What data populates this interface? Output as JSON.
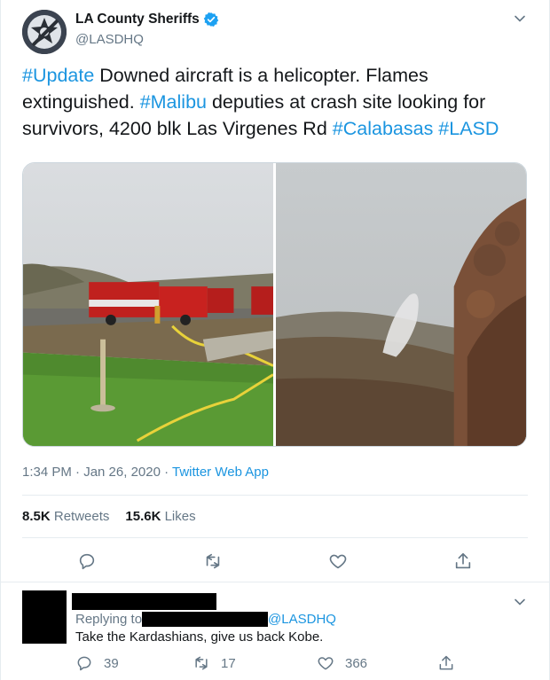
{
  "tweet": {
    "author_name": "LA County Sheriffs",
    "author_handle": "@LASDHQ",
    "text_segments": [
      {
        "text": "#Update",
        "tag": true
      },
      {
        "text": " Downed aircraft is a helicopter. Flames extinguished. ",
        "tag": false
      },
      {
        "text": "#Malibu",
        "tag": true
      },
      {
        "text": " deputies at crash site looking for survivors, 4200 blk Las Virgenes Rd ",
        "tag": false
      },
      {
        "text": "#Calabasas",
        "tag": true
      },
      {
        "text": " ",
        "tag": false
      },
      {
        "text": "#LASD",
        "tag": true
      }
    ],
    "timestamp": "1:34 PM · Jan 26, 2020 · ",
    "source_app": "Twitter Web App",
    "retweets_count": "8.5K",
    "retweets_label": " Retweets",
    "likes_count": "15.6K",
    "likes_label": " Likes"
  },
  "reply": {
    "replying_to_label": "Replying to ",
    "replying_to_handle": "@LASDHQ",
    "text": "Take the Kardashians, give us back Kobe.",
    "reply_count": "39",
    "retweet_count": "17",
    "like_count": "366"
  },
  "icons": {
    "verified": "verified-badge-icon",
    "caret": "chevron-down-icon",
    "reply": "reply-icon",
    "retweet": "retweet-icon",
    "like": "heart-icon",
    "share": "share-icon"
  },
  "colors": {
    "link": "#1b95e0",
    "secondary_text": "#657786",
    "primary_text": "#14171a",
    "divider": "#e6ecf0"
  }
}
